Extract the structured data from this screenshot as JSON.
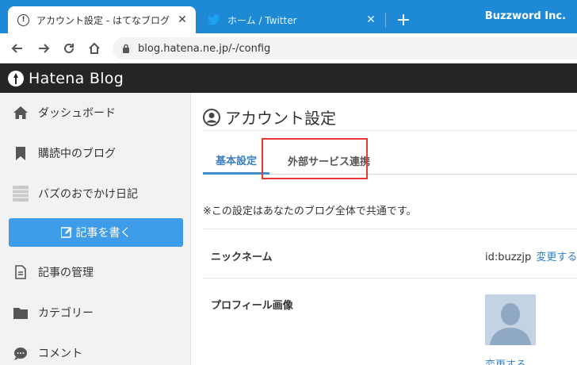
{
  "browser": {
    "active_tab_title": "アカウント設定 - はてなブログ",
    "inactive_tab_title": "ホーム / Twitter",
    "brand": "Buzzword Inc.",
    "url": "blog.hatena.ne.jp/-/config"
  },
  "header": {
    "logo_text": "Hatena Blog"
  },
  "sidebar": {
    "items": [
      {
        "label": "ダッシュボード",
        "icon": "home-icon"
      },
      {
        "label": "購読中のブログ",
        "icon": "bookmark-icon"
      },
      {
        "label": "バズのおでかけ日記",
        "icon": "blog-icon"
      },
      {
        "label": "記事の管理",
        "icon": "document-icon"
      },
      {
        "label": "カテゴリー",
        "icon": "folder-icon"
      },
      {
        "label": "コメント",
        "icon": "comment-icon"
      }
    ],
    "write_button": "記事を書く"
  },
  "main": {
    "title": "アカウント設定",
    "tabs": [
      {
        "label": "基本設定",
        "active": true
      },
      {
        "label": "外部サービス連携",
        "active": false
      }
    ],
    "note": "※この設定はあなたのブログ全体で共通です。",
    "nickname": {
      "label": "ニックネーム",
      "value": "id:buzzjp",
      "change": "変更する"
    },
    "profile_image": {
      "label": "プロフィール画像",
      "change": "変更する"
    }
  },
  "colors": {
    "tabstrip": "#1e8ad6",
    "header": "#252525",
    "accent": "#3f9ce8",
    "highlight": "#e53935"
  }
}
